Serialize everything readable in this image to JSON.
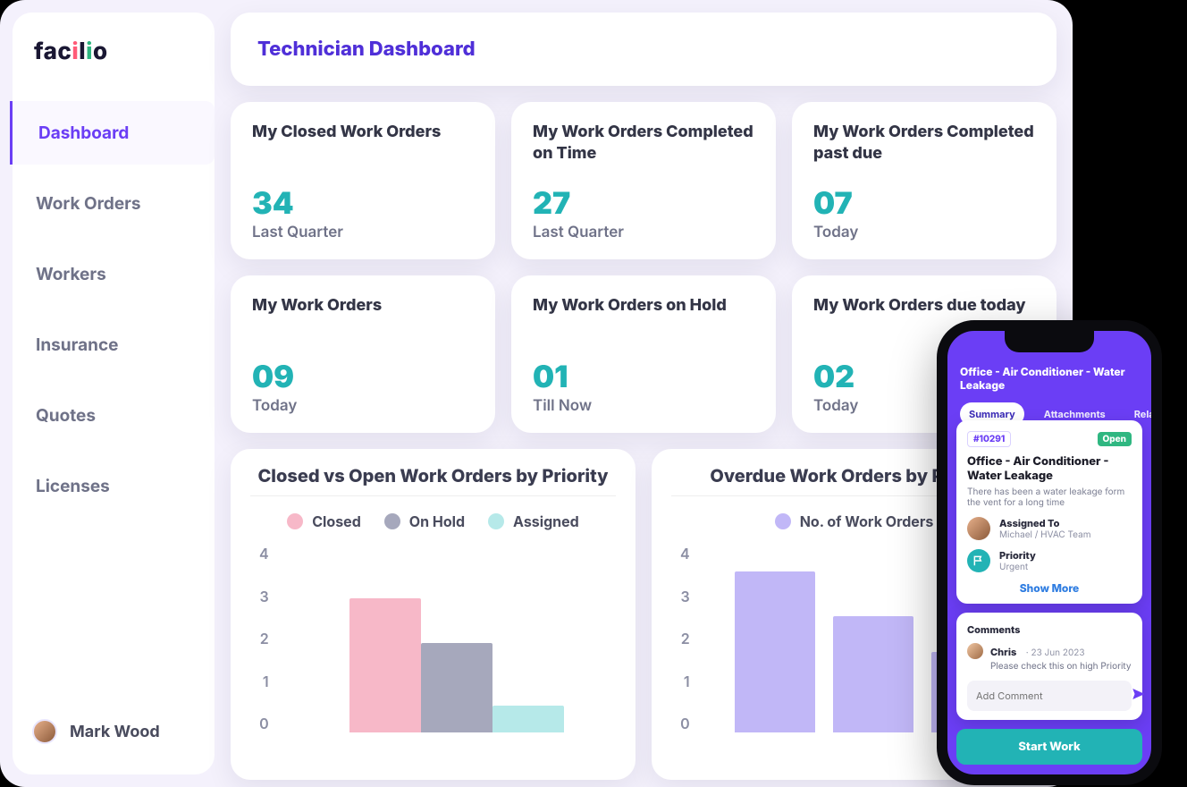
{
  "brand": "facilio",
  "page_title": "Technician Dashboard",
  "nav": {
    "items": [
      {
        "label": "Dashboard",
        "active": true
      },
      {
        "label": "Work Orders",
        "active": false
      },
      {
        "label": "Workers",
        "active": false
      },
      {
        "label": "Insurance",
        "active": false
      },
      {
        "label": "Quotes",
        "active": false
      },
      {
        "label": "Licenses",
        "active": false
      }
    ]
  },
  "user": {
    "name": "Mark Wood"
  },
  "stats": [
    {
      "title": "My Closed Work Orders",
      "value": "34",
      "sub": "Last Quarter"
    },
    {
      "title": "My Work Orders Completed on Time",
      "value": "27",
      "sub": "Last Quarter"
    },
    {
      "title": "My Work Orders Completed past due",
      "value": "07",
      "sub": "Today"
    },
    {
      "title": "My Work Orders",
      "value": "09",
      "sub": "Today"
    },
    {
      "title": "My Work Orders on Hold",
      "value": "01",
      "sub": "Till Now"
    },
    {
      "title": "My Work Orders due today",
      "value": "02",
      "sub": "Today"
    }
  ],
  "chart_data": [
    {
      "type": "bar",
      "title": "Closed vs Open Work Orders by Priority",
      "legend": [
        "Closed",
        "On Hold",
        "Assigned"
      ],
      "colors": [
        "#f7b8c8",
        "#a6a8bc",
        "#b6e9e9"
      ],
      "yticks": [
        0,
        1,
        2,
        3,
        4
      ],
      "series": [
        {
          "name": "Closed",
          "values": [
            3
          ]
        },
        {
          "name": "On Hold",
          "values": [
            2
          ]
        },
        {
          "name": "Assigned",
          "values": [
            0.6
          ]
        }
      ],
      "ylim": [
        0,
        4
      ]
    },
    {
      "type": "bar",
      "title": "Overdue Work Orders by Priority",
      "legend": [
        "No. of Work Orders"
      ],
      "colors": [
        "#c1b7f7"
      ],
      "yticks": [
        0,
        1,
        2,
        3,
        4
      ],
      "series": [
        {
          "name": "No. of Work Orders",
          "values": [
            3.6,
            2.6,
            1.8
          ]
        }
      ],
      "ylim": [
        0,
        4
      ]
    }
  ],
  "phone": {
    "header": "Office - Air Conditioner - Water Leakage",
    "tabs": [
      {
        "label": "Summary",
        "active": true
      },
      {
        "label": "Attachments",
        "active": false
      },
      {
        "label": "Related",
        "active": false
      }
    ],
    "wo": {
      "id": "#10291",
      "status": "Open",
      "title": "Office - Air Conditioner - Water Leakage",
      "desc": "There has been a water leakage form the vent for a long time",
      "assigned_label": "Assigned To",
      "assigned_value": "Michael / HVAC Team",
      "priority_label": "Priority",
      "priority_value": "Urgent",
      "show_more": "Show More"
    },
    "comments": {
      "title": "Comments",
      "author": "Chris",
      "date": "23 Jun 2023",
      "text": "Please check this on high Priority",
      "placeholder": "Add Comment"
    },
    "cta": "Start Work"
  }
}
